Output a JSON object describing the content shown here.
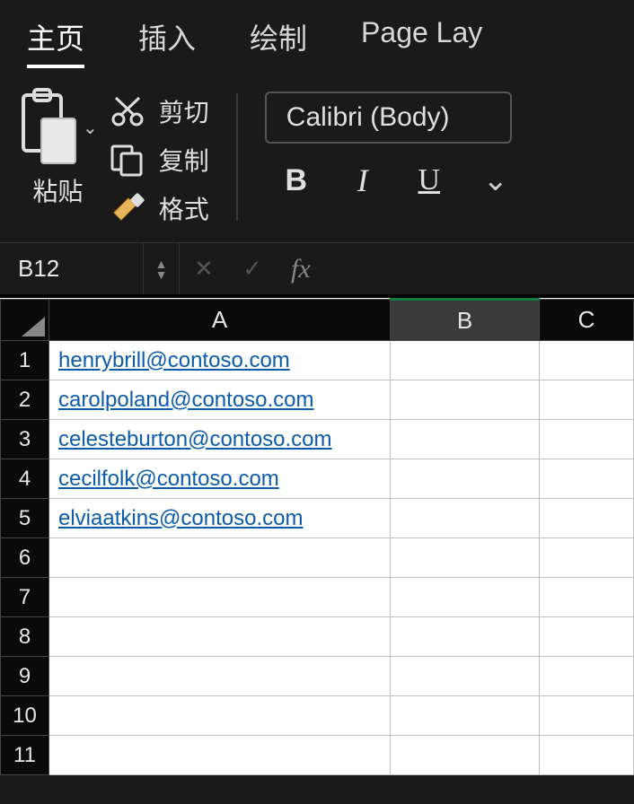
{
  "tabs": {
    "home": "主页",
    "insert": "插入",
    "draw": "绘制",
    "page_layout": "Page Lay"
  },
  "ribbon": {
    "paste_label": "粘贴",
    "cut_label": "剪切",
    "copy_label": "复制",
    "format_label": "格式",
    "font_name": "Calibri (Body)",
    "bold": "B",
    "italic": "I",
    "underline": "U"
  },
  "formula_bar": {
    "cell_ref": "B12",
    "fx_label": "fx",
    "formula_value": ""
  },
  "grid": {
    "columns": [
      "A",
      "B",
      "C"
    ],
    "selected_column": "B",
    "rows": [
      {
        "n": "1",
        "a": "henrybrill@contoso.com",
        "b": "",
        "c": ""
      },
      {
        "n": "2",
        "a": "carolpoland@contoso.com",
        "b": "",
        "c": ""
      },
      {
        "n": "3",
        "a": "celesteburton@contoso.com",
        "b": "",
        "c": ""
      },
      {
        "n": "4",
        "a": "cecilfolk@contoso.com",
        "b": "",
        "c": ""
      },
      {
        "n": "5",
        "a": "elviaatkins@contoso.com",
        "b": "",
        "c": ""
      },
      {
        "n": "6",
        "a": "",
        "b": "",
        "c": ""
      },
      {
        "n": "7",
        "a": "",
        "b": "",
        "c": ""
      },
      {
        "n": "8",
        "a": "",
        "b": "",
        "c": ""
      },
      {
        "n": "9",
        "a": "",
        "b": "",
        "c": ""
      },
      {
        "n": "10",
        "a": "",
        "b": "",
        "c": ""
      },
      {
        "n": "11",
        "a": "",
        "b": "",
        "c": ""
      }
    ]
  }
}
